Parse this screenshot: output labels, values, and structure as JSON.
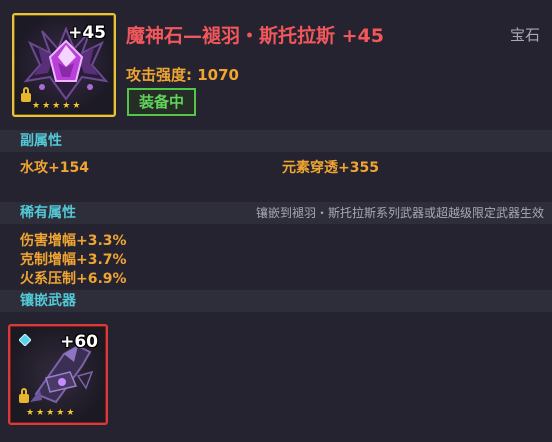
{
  "item": {
    "title": "魔神石—褪羽・斯托拉斯 +45",
    "category": "宝石",
    "enhance": "+45",
    "attack_label": "攻击强度: 1070",
    "status_label": "装备中",
    "stars": 5,
    "icon": "demon-gem-icon",
    "title_color": "#f2575c",
    "accent_color": "#f0a533"
  },
  "sub_attributes": {
    "title": "副属性",
    "stats": [
      "水攻+154",
      "元素穿透+355"
    ]
  },
  "rare_attributes": {
    "title": "稀有属性",
    "note": "镶嵌到褪羽・斯托拉斯系列武器或超越级限定武器生效",
    "stats": [
      "伤害增幅+3.3%",
      "克制增幅+3.7%",
      "火系压制+6.9%"
    ]
  },
  "socketed_weapon": {
    "title": "镶嵌武器",
    "enhance": "+60",
    "stars": 5,
    "icon": "weapon-icon"
  }
}
